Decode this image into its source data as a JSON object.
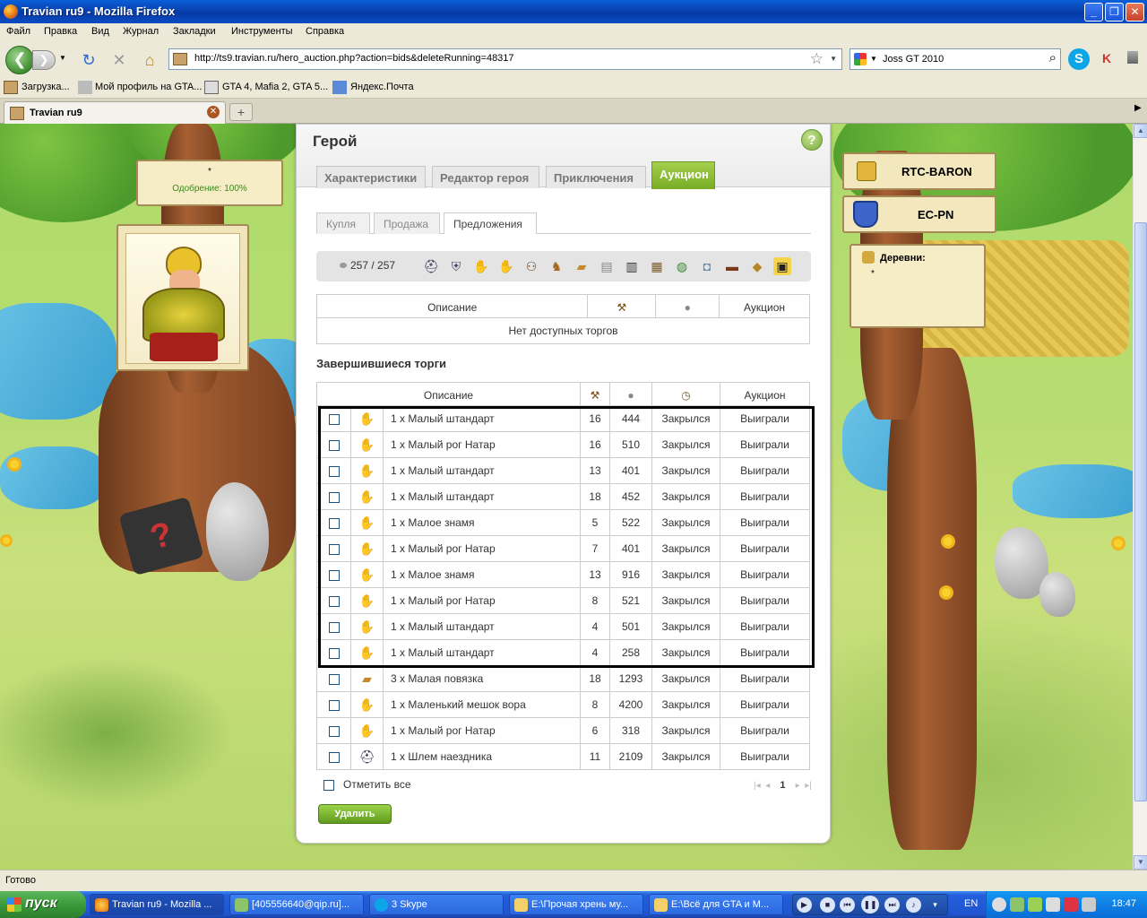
{
  "window": {
    "title": "Travian ru9 - Mozilla Firefox"
  },
  "menu": [
    "Файл",
    "Правка",
    "Вид",
    "Журнал",
    "Закладки",
    "Инструменты",
    "Справка"
  ],
  "nav": {
    "url": "http://ts9.travian.ru/hero_auction.php?action=bids&deleteRunning=48317",
    "search_value": "Joss GT 2010"
  },
  "bookmarks": [
    "Загрузка...",
    "Мой профиль на GTA...",
    "GTA 4, Mafia 2, GTA 5...",
    "Яндекс.Почта"
  ],
  "browser_tab": {
    "label": "Travian ru9"
  },
  "left_sign": {
    "name": "*",
    "approval": "Одобрение: 100%"
  },
  "right_panel": {
    "player1": "RTC-BARON",
    "player2": "EC-PN",
    "villages_label": "Деревни:",
    "village_item": "*"
  },
  "hero": {
    "title": "Герой",
    "tabs": [
      "Характеристики",
      "Редактор героя",
      "Приключения",
      "Аукцион"
    ],
    "active_tab": 3,
    "subtabs": [
      "Купля",
      "Продажа",
      "Предложения"
    ],
    "active_subtab": 2,
    "silver": "257 / 257"
  },
  "running_table": {
    "headers": [
      "Описание",
      "",
      "",
      "Аукцион"
    ],
    "empty_text": "Нет доступных торгов"
  },
  "finished": {
    "title": "Завершившиеся торги",
    "headers": [
      "Описание",
      "",
      "",
      "Аукцион"
    ],
    "rows": [
      {
        "icon": "hand",
        "desc": "1 x Малый штандарт",
        "bids": "16",
        "price": "444",
        "status": "Закрылся",
        "result": "Выиграли"
      },
      {
        "icon": "hand",
        "desc": "1 x Малый рог Натар",
        "bids": "16",
        "price": "510",
        "status": "Закрылся",
        "result": "Выиграли"
      },
      {
        "icon": "hand",
        "desc": "1 x Малый штандарт",
        "bids": "13",
        "price": "401",
        "status": "Закрылся",
        "result": "Выиграли"
      },
      {
        "icon": "hand",
        "desc": "1 x Малый штандарт",
        "bids": "18",
        "price": "452",
        "status": "Закрылся",
        "result": "Выиграли"
      },
      {
        "icon": "hand",
        "desc": "1 x Малое знамя",
        "bids": "5",
        "price": "522",
        "status": "Закрылся",
        "result": "Выиграли"
      },
      {
        "icon": "hand",
        "desc": "1 x Малый рог Натар",
        "bids": "7",
        "price": "401",
        "status": "Закрылся",
        "result": "Выиграли"
      },
      {
        "icon": "hand",
        "desc": "1 x Малое знамя",
        "bids": "13",
        "price": "916",
        "status": "Закрылся",
        "result": "Выиграли"
      },
      {
        "icon": "hand",
        "desc": "1 x Малый рог Натар",
        "bids": "8",
        "price": "521",
        "status": "Закрылся",
        "result": "Выиграли"
      },
      {
        "icon": "hand",
        "desc": "1 x Малый штандарт",
        "bids": "4",
        "price": "501",
        "status": "Закрылся",
        "result": "Выиграли"
      },
      {
        "icon": "hand",
        "desc": "1 x Малый штандарт",
        "bids": "4",
        "price": "258",
        "status": "Закрылся",
        "result": "Выиграли"
      },
      {
        "icon": "bandage",
        "desc": "3 x Малая повязка",
        "bids": "18",
        "price": "1293",
        "status": "Закрылся",
        "result": "Выиграли"
      },
      {
        "icon": "hand",
        "desc": "1 x Маленький мешок вора",
        "bids": "8",
        "price": "4200",
        "status": "Закрылся",
        "result": "Выиграли"
      },
      {
        "icon": "hand",
        "desc": "1 x Малый рог Натар",
        "bids": "6",
        "price": "318",
        "status": "Закрылся",
        "result": "Выиграли"
      },
      {
        "icon": "helmet",
        "desc": "1 x Шлем наездника",
        "bids": "11",
        "price": "2109",
        "status": "Закрылся",
        "result": "Выиграли"
      }
    ],
    "check_all": "Отметить все",
    "page": "1",
    "delete_label": "Удалить"
  },
  "status_bar": "Готово",
  "taskbar": {
    "start": "пуск",
    "tasks": [
      "Travian ru9 - Mozilla ...",
      "[405556640@qip.ru]...",
      "3 Skype",
      "E:\\Прочая хрень му...",
      "E:\\Всё для GTA и М..."
    ],
    "lang": "EN",
    "clock": "18:47"
  },
  "colors": {
    "accent_green": "#78ac25",
    "win_green": "#3a8a1a",
    "xp_blue": "#245edb"
  }
}
